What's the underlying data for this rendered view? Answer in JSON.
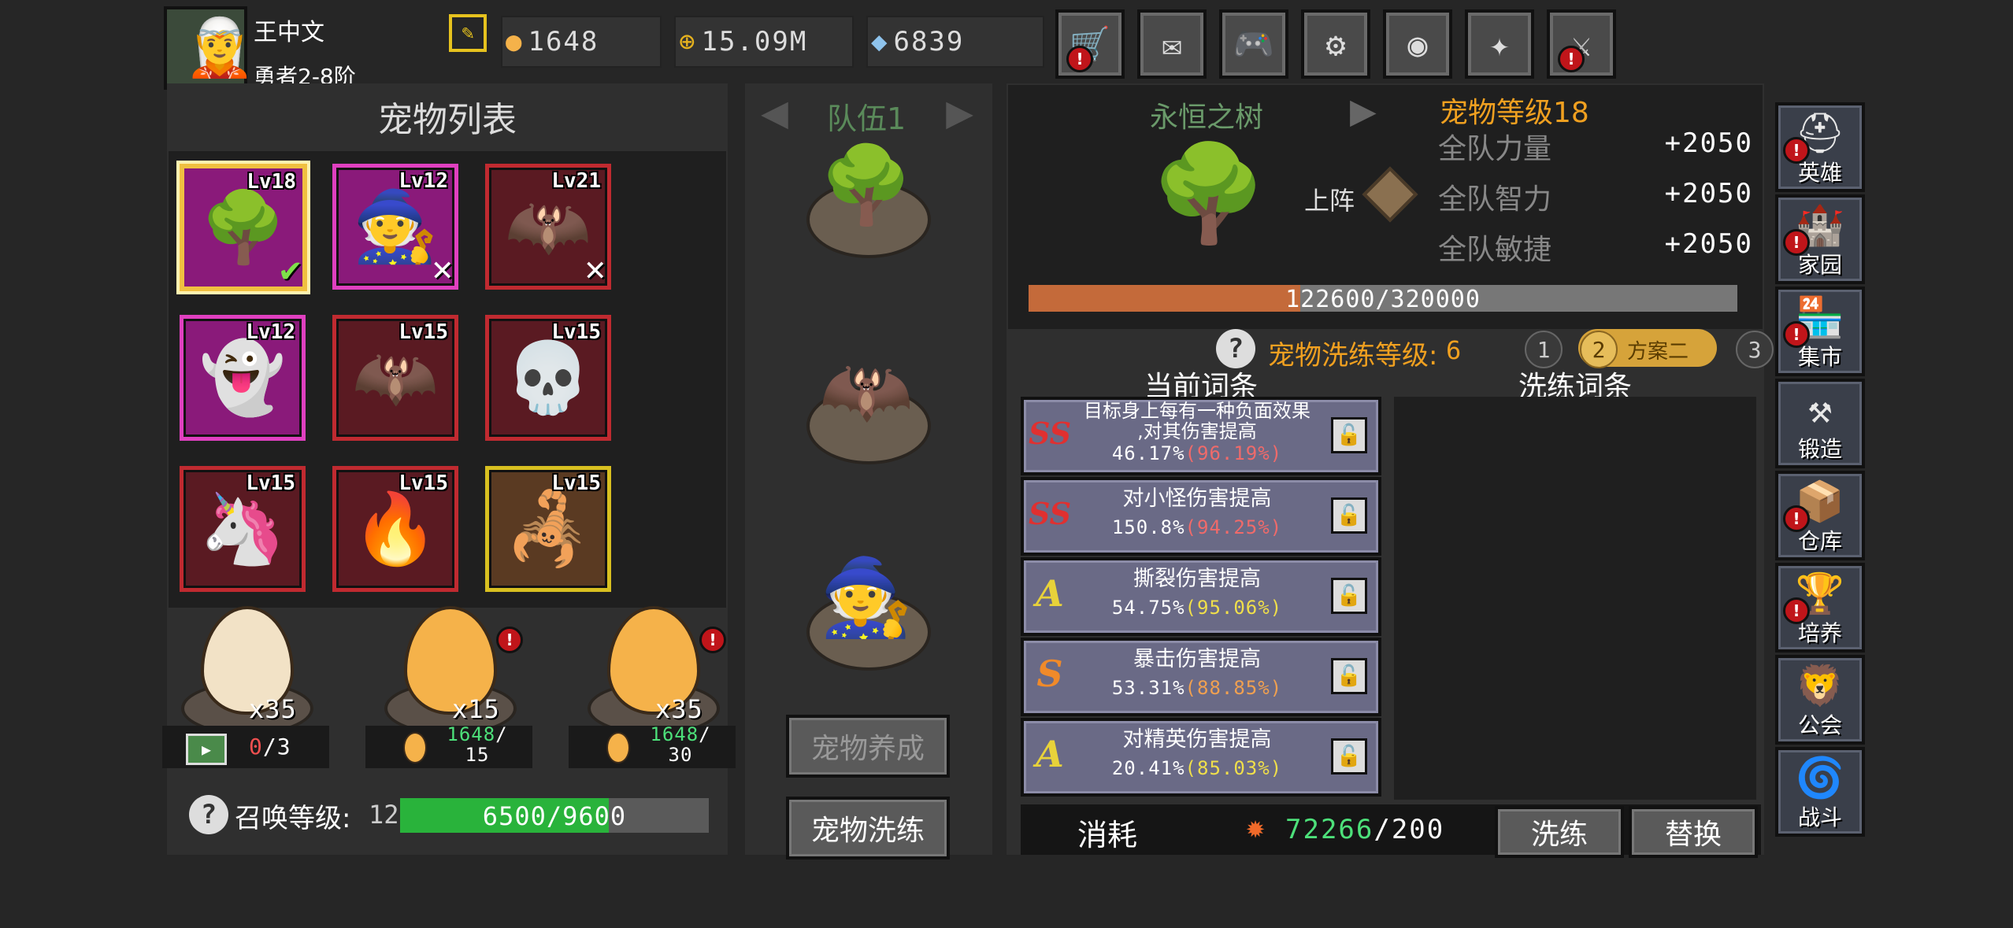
{
  "player": {
    "name": "王中文",
    "rank": "勇者2-8阶",
    "edit_icon": "pencil-icon"
  },
  "currencies": {
    "eggs": "1648",
    "gold": "15.09M",
    "gems": "6839"
  },
  "top_buttons": [
    {
      "name": "shop-cart-icon",
      "glyph": "🛒",
      "alert": true
    },
    {
      "name": "mail-icon",
      "glyph": "✉",
      "alert": false
    },
    {
      "name": "gamepad-icon",
      "glyph": "🎮",
      "alert": false
    },
    {
      "name": "settings-gear-icon",
      "glyph": "⚙",
      "alert": false
    },
    {
      "name": "color-wheel-icon",
      "glyph": "◉",
      "alert": false
    },
    {
      "name": "fireworks-icon",
      "glyph": "✦",
      "alert": false
    },
    {
      "name": "swords-icon",
      "glyph": "⚔",
      "alert": true
    }
  ],
  "pet_list": {
    "title": "宠物列表",
    "pets": [
      {
        "level": "Lv18",
        "art": "🌳",
        "rarity": "purple",
        "selected": true,
        "status": "✔"
      },
      {
        "level": "Lv12",
        "art": "🧙",
        "rarity": "pink",
        "selected": false,
        "status": "✕"
      },
      {
        "level": "Lv21",
        "art": "🦇",
        "rarity": "red",
        "selected": false,
        "status": "✕"
      },
      {
        "level": "Lv12",
        "art": "👻",
        "rarity": "pink",
        "selected": false,
        "status": ""
      },
      {
        "level": "Lv15",
        "art": "🦇",
        "rarity": "red",
        "selected": false,
        "status": ""
      },
      {
        "level": "Lv15",
        "art": "💀",
        "rarity": "red",
        "selected": false,
        "status": ""
      },
      {
        "level": "Lv15",
        "art": "🦄",
        "rarity": "red",
        "selected": false,
        "status": ""
      },
      {
        "level": "Lv15",
        "art": "🔥",
        "rarity": "red",
        "selected": false,
        "status": ""
      },
      {
        "level": "Lv15",
        "art": "🦂",
        "rarity": "yellow",
        "selected": false,
        "status": ""
      }
    ]
  },
  "eggs": [
    {
      "count": "x35",
      "color": "#f2e2c6",
      "alert": false,
      "cost_main": "0",
      "cost_rest": "/3",
      "cost_icon": "video-ad-icon",
      "cost_second": ""
    },
    {
      "count": "x15",
      "color": "#f5b24a",
      "alert": true,
      "cost_main": "1648",
      "cost_rest": "/",
      "cost_icon": "egg-icon",
      "cost_second": "15"
    },
    {
      "count": "x35",
      "color": "#f5b24a",
      "alert": true,
      "cost_main": "1648",
      "cost_rest": "/",
      "cost_icon": "egg-icon",
      "cost_second": "30"
    }
  ],
  "summon": {
    "label": "召唤等级:",
    "level": "12",
    "progress_text": "6500/9600",
    "progress": 0.677
  },
  "team": {
    "label": "队伍1",
    "train_button": "宠物养成",
    "refine_button": "宠物洗练",
    "slots": [
      "🌳",
      "🦇",
      "🧙"
    ]
  },
  "pet_detail": {
    "name": "永恒之树",
    "pet_level_label": "宠物等级18",
    "deploy_label": "上阵",
    "stats": [
      {
        "label": "全队力量",
        "value": "+2050"
      },
      {
        "label": "全队智力",
        "value": "+2050"
      },
      {
        "label": "全队敏捷",
        "value": "+2050"
      }
    ],
    "exp_text": "122600/320000",
    "exp_progress": 0.383
  },
  "refine": {
    "level_label": "宠物洗练等级:",
    "level_value": "6",
    "plans": [
      "1",
      "2",
      "3"
    ],
    "plan_active_label": "方案二",
    "current_header": "当前词条",
    "refine_header": "洗练词条",
    "traits": [
      {
        "grade": "SS",
        "grade_color": "#e03030",
        "text1": "目标身上每有一种负面效果",
        "text2": ",对其伤害提高",
        "value": "46.17%",
        "pct": "(96.19%)",
        "pct_color": "#f06a6a"
      },
      {
        "grade": "SS",
        "grade_color": "#e03030",
        "text1": "对小怪伤害提高",
        "text2": "",
        "value": "150.8%",
        "pct": "(94.25%)",
        "pct_color": "#f06a6a"
      },
      {
        "grade": "A",
        "grade_color": "#e8d23a",
        "text1": "撕裂伤害提高",
        "text2": "",
        "value": "54.75%",
        "pct": "(95.06%)",
        "pct_color": "#f0df4a"
      },
      {
        "grade": "S",
        "grade_color": "#f08a2a",
        "text1": "暴击伤害提高",
        "text2": "",
        "value": "53.31%",
        "pct": "(88.85%)",
        "pct_color": "#f0a050"
      },
      {
        "grade": "A",
        "grade_color": "#e8d23a",
        "text1": "对精英伤害提高",
        "text2": "",
        "value": "20.41%",
        "pct": "(85.03%)",
        "pct_color": "#f0df4a"
      }
    ],
    "cost_label": "消耗",
    "cost_value": "72266",
    "cost_need": "/200",
    "refine_button": "洗练",
    "replace_button": "替换"
  },
  "side_menu": [
    {
      "label": "英雄",
      "glyph": "⛑",
      "alert": true
    },
    {
      "label": "家园",
      "glyph": "🏰",
      "alert": true
    },
    {
      "label": "集市",
      "glyph": "🏪",
      "alert": true
    },
    {
      "label": "锻造",
      "glyph": "⚒",
      "alert": false
    },
    {
      "label": "仓库",
      "glyph": "📦",
      "alert": true
    },
    {
      "label": "培养",
      "glyph": "🏆",
      "alert": true
    },
    {
      "label": "公会",
      "glyph": "🦁",
      "alert": false
    },
    {
      "label": "战斗",
      "glyph": "🌀",
      "alert": false
    }
  ]
}
